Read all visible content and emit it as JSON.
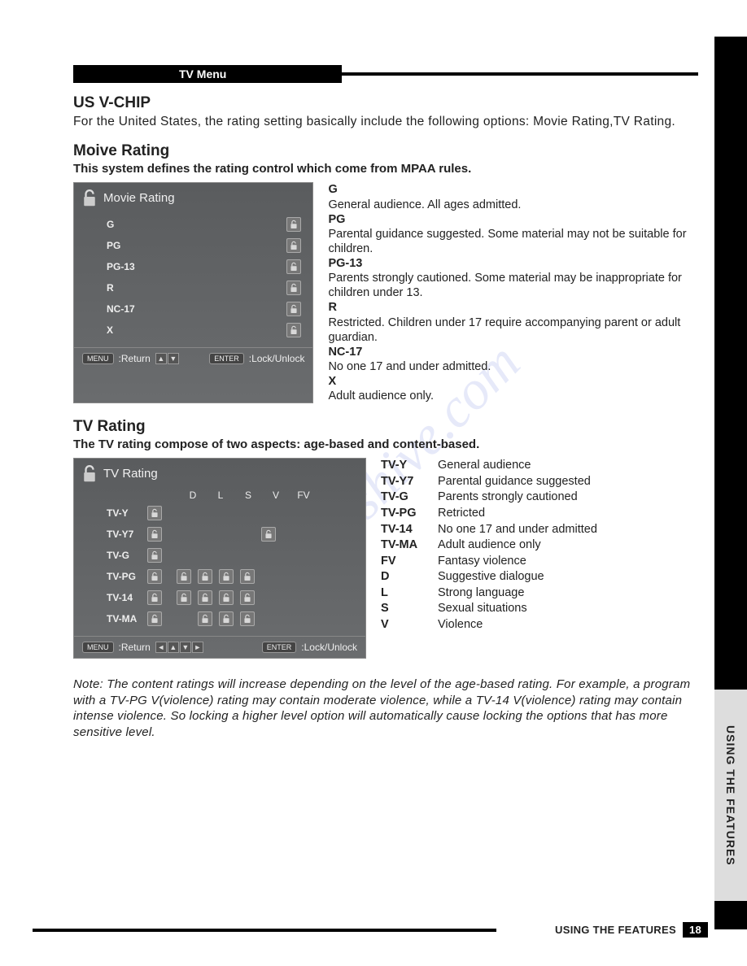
{
  "header": {
    "tab": "TV Menu"
  },
  "vchip": {
    "title": "US V-CHIP",
    "intro": "For the United States, the rating setting basically include the following options: Movie Rating,TV Rating."
  },
  "movie": {
    "title": "Moive Rating",
    "subtitle": "This system defines the rating control which come from MPAA rules.",
    "panel_title": "Movie Rating",
    "ratings": [
      "G",
      "PG",
      "PG-13",
      "R",
      "NC-17",
      "X"
    ],
    "footer_return": ":Return",
    "footer_menu": "MENU",
    "footer_enter": "ENTER",
    "footer_lock": ":Lock/Unlock",
    "defs": [
      {
        "k": "G",
        "v": "General  audience. All ages admitted."
      },
      {
        "k": "PG",
        "v": "Parental guidance suggested. Some material may not be suitable for children."
      },
      {
        "k": "PG-13",
        "v": "Parents strongly cautioned. Some material may be inappropriate for children under 13."
      },
      {
        "k": "R",
        "v": "Restricted. Children under 17 require accompanying parent or adult guardian."
      },
      {
        "k": "NC-17",
        "v": "No one 17 and under admitted."
      },
      {
        "k": "X",
        "v": "Adult audience only."
      }
    ]
  },
  "tv": {
    "title": "TV Rating",
    "subtitle": "The TV rating compose of two aspects: age-based and content-based.",
    "panel_title": "TV Rating",
    "cols": [
      "D",
      "L",
      "S",
      "V",
      "FV"
    ],
    "rows": [
      {
        "label": "TV-Y",
        "age": true,
        "grid": [
          false,
          false,
          false,
          false,
          false
        ]
      },
      {
        "label": "TV-Y7",
        "age": true,
        "grid": [
          false,
          false,
          false,
          false,
          true
        ]
      },
      {
        "label": "TV-G",
        "age": true,
        "grid": [
          false,
          false,
          false,
          false,
          false
        ]
      },
      {
        "label": "TV-PG",
        "age": true,
        "grid": [
          true,
          true,
          true,
          true,
          false
        ]
      },
      {
        "label": "TV-14",
        "age": true,
        "grid": [
          true,
          true,
          true,
          true,
          false
        ]
      },
      {
        "label": "TV-MA",
        "age": true,
        "grid": [
          false,
          true,
          true,
          true,
          false
        ]
      }
    ],
    "footer_return": ":Return",
    "footer_menu": "MENU",
    "footer_enter": "ENTER",
    "footer_lock": ":Lock/Unlock",
    "defs": [
      {
        "k": "TV-Y",
        "v": "General  audience"
      },
      {
        "k": "TV-Y7",
        "v": "Parental guidance suggested"
      },
      {
        "k": "TV-G",
        "v": "Parents strongly cautioned"
      },
      {
        "k": "TV-PG",
        "v": "Retricted"
      },
      {
        "k": "TV-14",
        "v": "No one 17 and under admitted"
      },
      {
        "k": "TV-MA",
        "v": "Adult audience only"
      },
      {
        "k": "FV",
        "v": "Fantasy violence"
      },
      {
        "k": "D",
        "v": "Suggestive dialogue"
      },
      {
        "k": "L",
        "v": "Strong language"
      },
      {
        "k": "S",
        "v": "Sexual situations"
      },
      {
        "k": "V",
        "v": "Violence"
      }
    ]
  },
  "note": "Note: The content ratings will increase depending on the level of the age-based rating. For example, a program with a TV-PG V(violence) rating may contain moderate violence, while a TV-14 V(violence) rating may contain intense violence. So locking a higher level option will automatically cause locking the options that has more sensitive level.",
  "side_label": "USING THE FEATURES",
  "footer": {
    "label": "USING THE FEATURES",
    "page": "18"
  },
  "watermark": "manualshive.com"
}
